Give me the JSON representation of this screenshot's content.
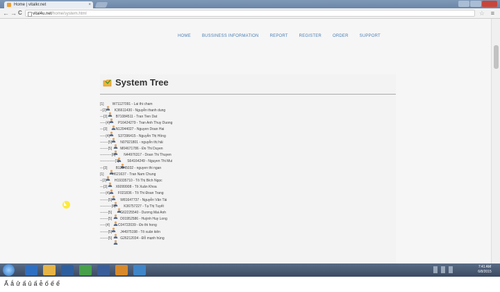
{
  "browser": {
    "tab_title": "Home | vitalkr.net",
    "tab_close": "×",
    "url_host": "vital4u.net",
    "url_path": "/home/system.html",
    "back": "←",
    "forward": "→",
    "reload": "C",
    "star": "☆",
    "menu": "≡"
  },
  "nav": {
    "items": [
      "HOME",
      "BUSSINESS INFORMATION",
      "REPORT",
      "REGISTER",
      "ORDER",
      "SUPPORT"
    ],
    "active": "HOME",
    "color": "#4a7fb5"
  },
  "page": {
    "title": "System Tree"
  },
  "tree": [
    {
      "prefix": "",
      "level": "[1]",
      "text": "W71127091 - Lai thi cham"
    },
    {
      "prefix": "--",
      "level": "[2]",
      "text": "K36611430 - Nguyễn thanh dung"
    },
    {
      "prefix": "---",
      "level": "[3]",
      "text": "B71084511 - Tran Tien Dat"
    },
    {
      "prefix": "-----",
      "level": "[4]",
      "text": "P16424279 - Tran Anh Thuy Duong"
    },
    {
      "prefix": "---",
      "level": "[3]",
      "text": "N12044027 - Nguyen Doan Hai"
    },
    {
      "prefix": "-----",
      "level": "[4]",
      "text": "S37396415 - Nguyễn Thị Hồng"
    },
    {
      "prefix": "-------",
      "level": "[5]",
      "text": "N07921801 - nguyễn thị hải"
    },
    {
      "prefix": "-------",
      "level": "[5]",
      "text": "M04671786 - Đo Thi Duyen"
    },
    {
      "prefix": "----------",
      "level": "[6]",
      "text": "N44976317 - Doan Thi Thuyen"
    },
    {
      "prefix": "-------------",
      "level": "[7]",
      "text": "S64164249 - Nguyen Thi Mui"
    },
    {
      "prefix": "---",
      "level": "[3]",
      "text": "B12945032 - nguyen thi ngan"
    },
    {
      "prefix": "",
      "level": "[1]",
      "text": "H621637 - Tran Nam Chung"
    },
    {
      "prefix": "--",
      "level": "[2]",
      "text": "H19335710 - Tô Thị Bích Ngọc"
    },
    {
      "prefix": "---",
      "level": "[3]",
      "text": "X6099908 - Tô Xuân Khoa"
    },
    {
      "prefix": "-----",
      "level": "[4]",
      "text": "F021836 - Tô Thi Đoan Trang"
    },
    {
      "prefix": "-------",
      "level": "[5]",
      "text": "W81647737 - Nguyễn Văn Tài"
    },
    {
      "prefix": "----------",
      "level": "[6]",
      "text": "K36757227 - Tạ Thị Tuyết"
    },
    {
      "prefix": "-------",
      "level": "[5]",
      "text": "G62225540 - Dương Mai Anh"
    },
    {
      "prefix": "-------",
      "level": "[5]",
      "text": "D01952586 - Huỳnh Huy Long"
    },
    {
      "prefix": "-----",
      "level": "[4]",
      "text": "C04722039 - Đo thi hong"
    },
    {
      "prefix": "-------",
      "level": "[5]",
      "text": "J44975198 - Tô xuân kiên"
    },
    {
      "prefix": "-------",
      "level": "[5]",
      "text": "G26212034 - Đỗ mạnh hùng"
    }
  ],
  "taskbar": {
    "time": "7:41 AM",
    "date": "6/8/2015"
  },
  "caption": {
    "text": "Ấ                    ắ    ử     ấ          ủ           ấ                 ễ     ố      ế    ể"
  },
  "colors": {
    "titlebar": "#6a86a8",
    "taskbar": "#3b4a61",
    "cursor_highlight": "#ffe600"
  }
}
